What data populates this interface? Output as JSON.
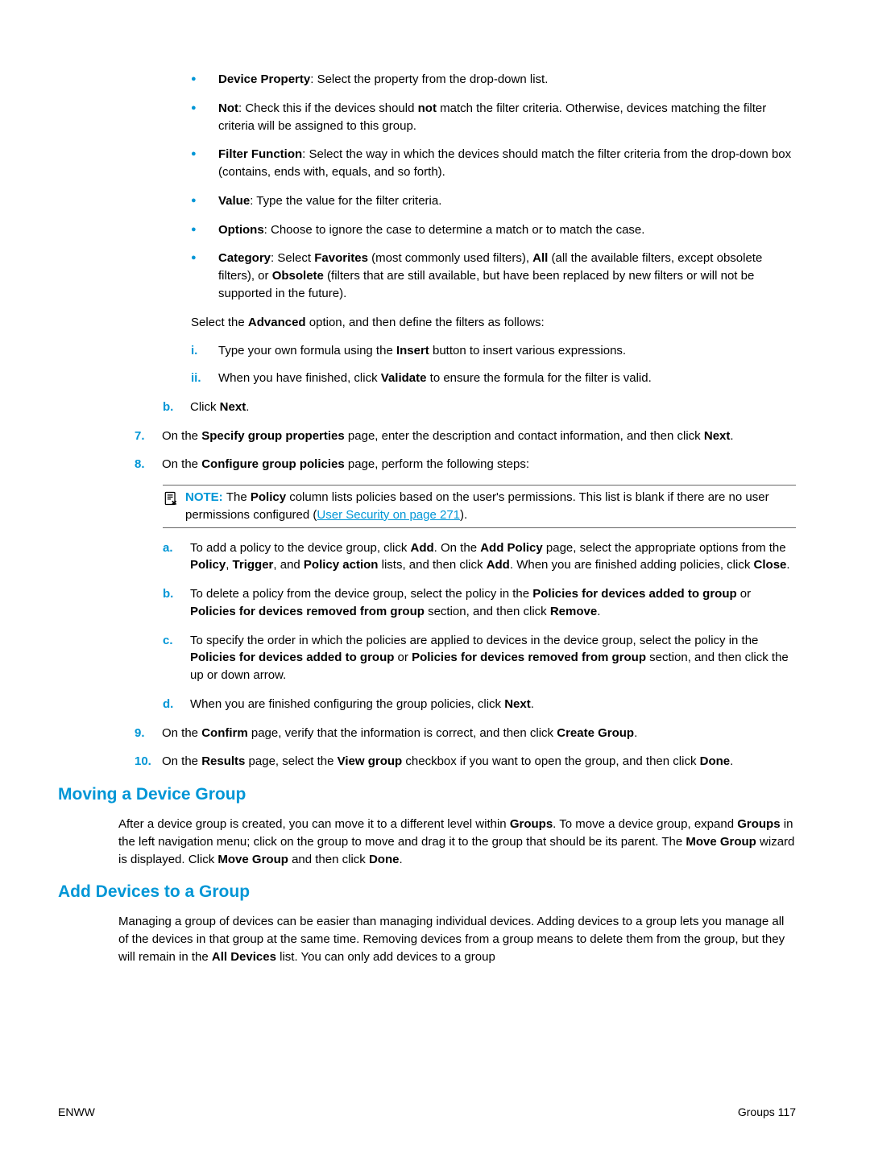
{
  "bullets": {
    "deviceProperty": {
      "term": "Device Property",
      "rest": ": Select the property from the drop-down list."
    },
    "not": {
      "term": "Not",
      "mid": ": Check this if the devices should ",
      "bold2": "not",
      "rest": " match the filter criteria. Otherwise, devices matching the filter criteria will be assigned to this group."
    },
    "filterFunction": {
      "term": "Filter Function",
      "rest": ": Select the way in which the devices should match the filter criteria from the drop-down box (contains, ends with, equals, and so forth)."
    },
    "value": {
      "term": "Value",
      "rest": ": Type the value for the filter criteria."
    },
    "options": {
      "term": "Options",
      "rest": ": Choose to ignore the case to determine a match or to match the case."
    },
    "category": {
      "term": "Category",
      "p1": ": Select ",
      "fav": "Favorites",
      "p2": " (most commonly used filters), ",
      "all": "All",
      "p3": " (all the available filters, except obsolete filters), or ",
      "obs": "Obsolete",
      "p4": " (filters that are still available, but have been replaced by new filters or will not be supported in the future)."
    }
  },
  "advanced": {
    "p1": "Select the ",
    "b": "Advanced",
    "p2": " option, and then define the filters as follows:"
  },
  "roman": {
    "i": {
      "marker": "i.",
      "p1": "Type your own formula using the ",
      "b": "Insert",
      "p2": " button to insert various expressions."
    },
    "ii": {
      "marker": "ii.",
      "p1": "When you have finished, click ",
      "b": "Validate",
      "p2": " to ensure the formula for the filter is valid."
    }
  },
  "subB": {
    "marker": "b.",
    "p1": "Click ",
    "b": "Next",
    "p2": "."
  },
  "num7": {
    "marker": "7.",
    "p1": "On the ",
    "b": "Specify group properties",
    "p2": " page, enter the description and contact information, and then click ",
    "b2": "Next",
    "p3": "."
  },
  "num8": {
    "marker": "8.",
    "p1": "On the ",
    "b": "Configure group policies",
    "p2": " page, perform the following steps:"
  },
  "note": {
    "label": "NOTE:   ",
    "p1": "The ",
    "b": "Policy",
    "p2": " column lists policies based on the user's permissions. This list is blank if there are no user permissions configured (",
    "link": "User Security on page 271",
    "p3": ")."
  },
  "alpha": {
    "a": {
      "marker": "a.",
      "p1": "To add a policy to the device group, click ",
      "b1": "Add",
      "p2": ". On the ",
      "b2": "Add Policy",
      "p3": " page, select the appropriate options from the ",
      "b3": "Policy",
      "p4": ", ",
      "b4": "Trigger",
      "p5": ", and ",
      "b5": "Policy action",
      "p6": " lists, and then click ",
      "b6": "Add",
      "p7": ". When you are finished adding policies, click ",
      "b7": "Close",
      "p8": "."
    },
    "b": {
      "marker": "b.",
      "p1": "To delete a policy from the device group, select the policy in the ",
      "b1": "Policies for devices added to group",
      "p2": " or ",
      "b2": "Policies for devices removed from group",
      "p3": " section, and then click ",
      "b3": "Remove",
      "p4": "."
    },
    "c": {
      "marker": "c.",
      "p1": "To specify the order in which the policies are applied to devices in the device group, select the policy in the ",
      "b1": "Policies for devices added to group",
      "p2": " or ",
      "b2": "Policies for devices removed from group",
      "p3": " section, and then click the up or down arrow."
    },
    "d": {
      "marker": "d.",
      "p1": "When you are finished configuring the group policies, click ",
      "b1": "Next",
      "p2": "."
    }
  },
  "num9": {
    "marker": "9.",
    "p1": "On the ",
    "b1": "Confirm",
    "p2": " page, verify that the information is correct, and then click ",
    "b2": "Create Group",
    "p3": "."
  },
  "num10": {
    "marker": "10.",
    "p1": "On the ",
    "b1": "Results",
    "p2": " page, select the ",
    "b2": "View group",
    "p3": " checkbox if you want to open the group, and then click ",
    "b3": "Done",
    "p4": "."
  },
  "h2_move": "Moving a Device Group",
  "movePara": {
    "p1": "After a device group is created, you can move it to a different level within ",
    "b1": "Groups",
    "p2": ". To move a device group, expand ",
    "b2": "Groups",
    "p3": " in the left navigation menu; click on the group to move and drag it to the group that should be its parent. The ",
    "b3": "Move Group",
    "p4": " wizard is displayed. Click ",
    "b4": "Move Group",
    "p5": " and then click ",
    "b5": "Done",
    "p6": "."
  },
  "h2_add": "Add Devices to a Group",
  "addPara": {
    "p1": "Managing a group of devices can be easier than managing individual devices. Adding devices to a group lets you manage all of the devices in that group at the same time. Removing devices from a group means to delete them from the group, but they will remain in the ",
    "b1": "All Devices",
    "p2": " list. You can only add devices to a group"
  },
  "footer": {
    "left": "ENWW",
    "right": "Groups   117"
  }
}
